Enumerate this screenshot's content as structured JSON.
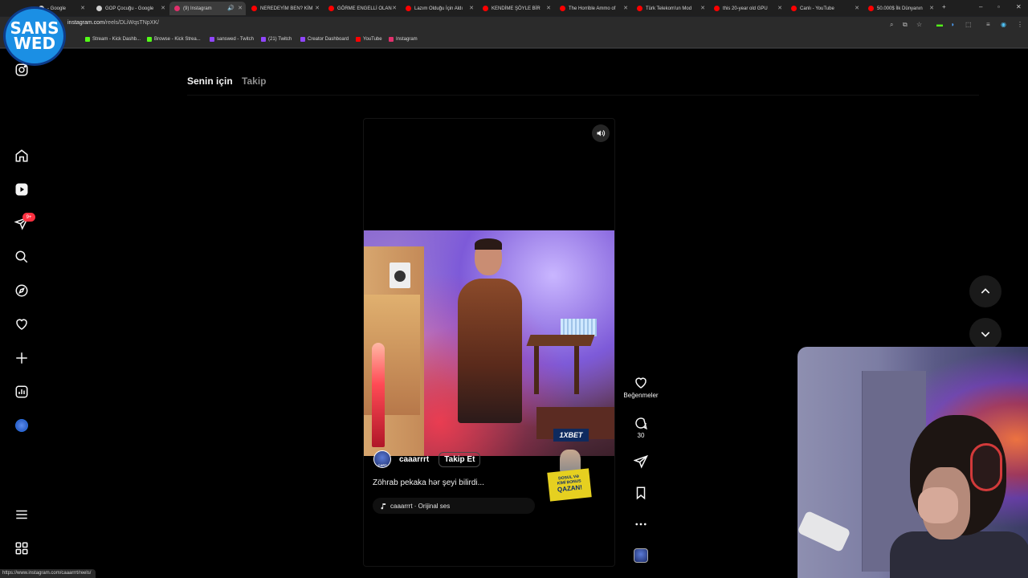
{
  "browser": {
    "tabs": [
      {
        "label": "- Google",
        "favicon_color": "#d0d0d0"
      },
      {
        "label": "GOP Çocuğu - Google",
        "favicon_color": "#d0d0d0"
      },
      {
        "label": "(9) Instagram",
        "favicon_color": "#e1306c",
        "active": true
      },
      {
        "label": "NEREDEYİM BEN? KİM",
        "favicon_color": "#ff0000"
      },
      {
        "label": "GÖRME ENGELLİ OLAN",
        "favicon_color": "#ff0000"
      },
      {
        "label": "Lazım Olduğu İçin Aldı",
        "favicon_color": "#ff0000"
      },
      {
        "label": "KENDİME ŞÖYLE BİR",
        "favicon_color": "#ff0000"
      },
      {
        "label": "The Horrible Ammo of",
        "favicon_color": "#ff0000"
      },
      {
        "label": "Türk Telekom'un Mod",
        "favicon_color": "#ff0000"
      },
      {
        "label": "this 20-year old GPU",
        "favicon_color": "#ff0000"
      },
      {
        "label": "Canlı - YouTube",
        "favicon_color": "#ff0000"
      },
      {
        "label": "50.000$ İlk Dünyanın",
        "favicon_color": "#ff0000"
      }
    ],
    "url_host": "instagram.com",
    "url_path": "/reels/DLiWqsTNpXK/",
    "bookmarks": [
      {
        "label": "Stream - Kick Dashb...",
        "color": "#53fc18"
      },
      {
        "label": "Browse - Kick Strea...",
        "color": "#53fc18"
      },
      {
        "label": "sanswed - Twitch",
        "color": "#9146ff"
      },
      {
        "label": "(21) Twitch",
        "color": "#9146ff"
      },
      {
        "label": "Creator Dashboard",
        "color": "#9146ff"
      },
      {
        "label": "YouTube",
        "color": "#ff0000"
      },
      {
        "label": "Instagram",
        "color": "#e1306c"
      }
    ],
    "status_url": "https://www.instagram.com/caaarrrt/reels/"
  },
  "stream_logo": {
    "line1": "SANS",
    "line2": "WED"
  },
  "sidebar": {
    "notification_badge": "9+",
    "icons": [
      "instagram-icon",
      "home-icon",
      "reels-icon",
      "direct-message-icon",
      "search-icon",
      "explore-icon",
      "notifications-heart-icon",
      "create-plus-icon",
      "dashboard-icon",
      "profile-avatar",
      "more-menu-icon",
      "also-from-meta-icon"
    ]
  },
  "topnav": {
    "for_you": "Senin için",
    "following": "Takip"
  },
  "reel": {
    "username": "caaarrrt",
    "follow_label": "Takip Et",
    "caption": "Zöhrab pekaka hər şeyi bilirdi...",
    "audio": "caaarrrt · Orijinal ses",
    "sponsor_logo": "1XBET",
    "ad_text": {
      "line1": "DOSUL VƏ",
      "line2": "KİMİ BONUS",
      "line3": "QAZAN!"
    },
    "avatar_text": "CART"
  },
  "actions": {
    "like_label": "Beğenmeler",
    "comment_count": "30"
  },
  "colors": {
    "background": "#000000",
    "badge": "#ff3040",
    "accent_blue": "#1b8fe4"
  }
}
